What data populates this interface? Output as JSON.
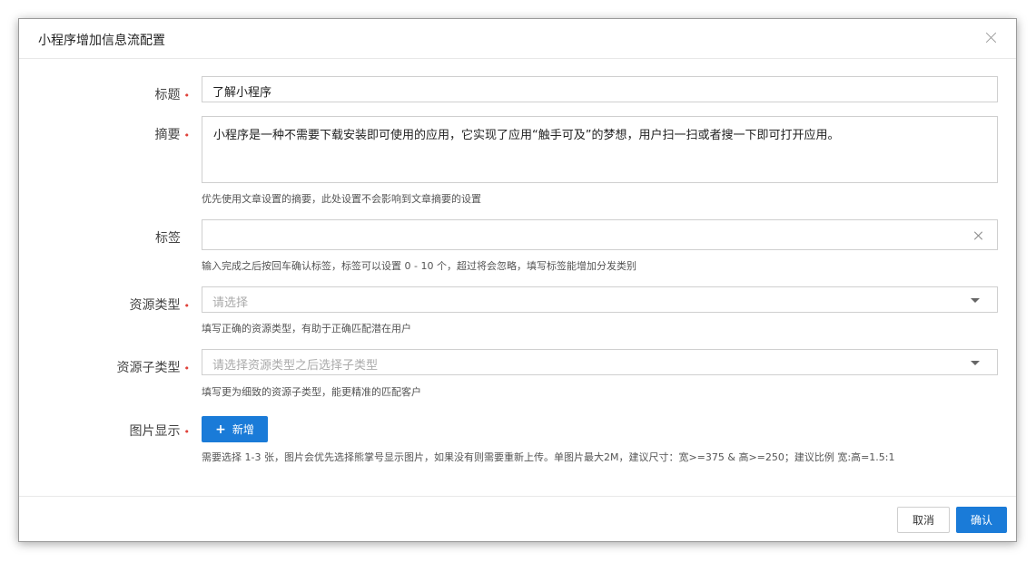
{
  "dialog": {
    "title": "小程序增加信息流配置",
    "close_icon": "close-icon"
  },
  "form": {
    "title": {
      "label": "标题",
      "required": "•",
      "value": "了解小程序"
    },
    "summary": {
      "label": "摘要",
      "required": "•",
      "value": "小程序是一种不需要下载安装即可使用的应用，它实现了应用“触手可及”的梦想，用户扫一扫或者搜一下即可打开应用。",
      "hint": "优先使用文章设置的摘要，此处设置不会影响到文章摘要的设置"
    },
    "tags": {
      "label": "标签",
      "value": "",
      "hint": "输入完成之后按回车确认标签，标签可以设置 0 - 10 个，超过将会忽略，填写标签能增加分发类别"
    },
    "resource_type": {
      "label": "资源类型",
      "required": "•",
      "placeholder": "请选择",
      "hint": "填写正确的资源类型，有助于正确匹配潜在用户"
    },
    "resource_subtype": {
      "label": "资源子类型",
      "required": "•",
      "placeholder": "请选择资源类型之后选择子类型",
      "hint": "填写更为细致的资源子类型，能更精准的匹配客户"
    },
    "image": {
      "label": "图片显示",
      "required": "•",
      "add_label": "新增",
      "add_icon": "plus-icon",
      "hint": "需要选择 1-3 张，图片会优先选择熊掌号显示图片，如果没有则需要重新上传。单图片最大2M，建议尺寸：宽>=375 & 高>=250；建议比例 宽:高=1.5:1"
    }
  },
  "footer": {
    "cancel_label": "取消",
    "confirm_label": "确认"
  },
  "colors": {
    "primary": "#1a7bd8",
    "required": "#e0423a"
  }
}
